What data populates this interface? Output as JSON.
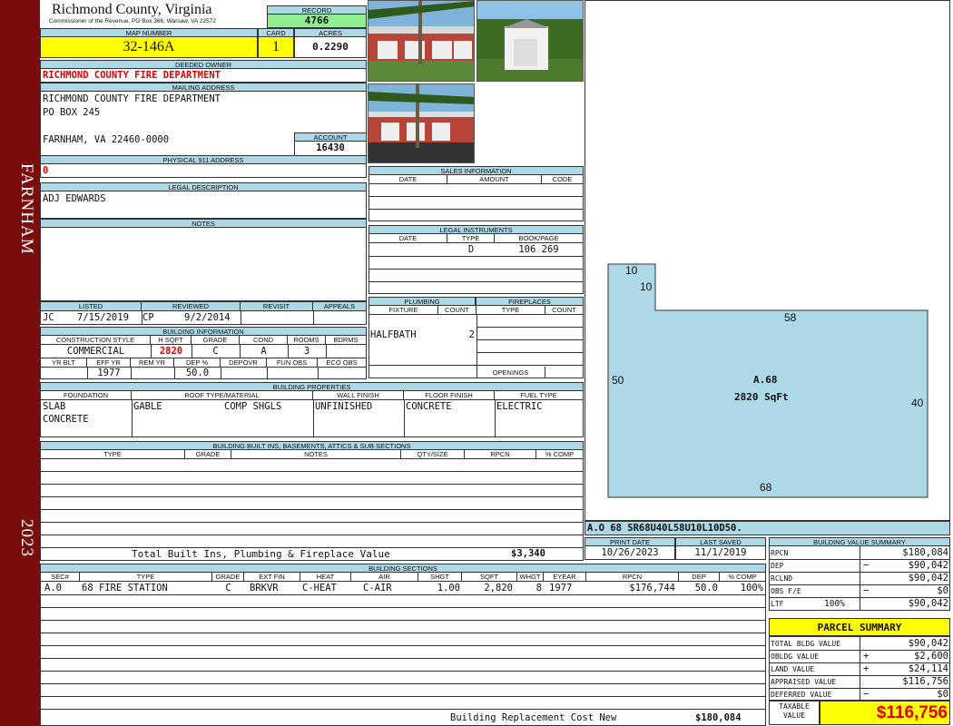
{
  "sidebar": {
    "town": "FARNHAM",
    "year": "2023"
  },
  "header": {
    "county": "Richmond County, Virginia",
    "address": "Commissioner of the Revenue, PO Box 366, Warsaw, VA 22572",
    "record_label": "RECORD",
    "record": "4766",
    "map_number_label": "MAP NUMBER",
    "map_number": "32-146A",
    "card_label": "CARD",
    "card": "1",
    "acres_label": "ACRES",
    "acres": "0.2290"
  },
  "owner": {
    "label": "DEEDED OWNER",
    "name": "RICHMOND COUNTY FIRE DEPARTMENT"
  },
  "mailing": {
    "label": "MAILING ADDRESS",
    "line1": "RICHMOND COUNTY FIRE DEPARTMENT",
    "line2": "PO BOX 245",
    "line3": "FARNHAM, VA 22460-0000"
  },
  "account": {
    "label": "ACCOUNT",
    "value": "16430"
  },
  "physical": {
    "label": "PHYSICAL 911 ADDRESS",
    "value": "0"
  },
  "legal": {
    "label": "LEGAL DESCRIPTION",
    "value": "ADJ EDWARDS"
  },
  "notes": {
    "label": "NOTES"
  },
  "review": {
    "listed_label": "LISTED",
    "reviewed_label": "REVIEWED",
    "revisit_label": "REVISIT",
    "appeals_label": "APPEALS",
    "listed_by": "JC",
    "listed_date": "7/15/2019",
    "reviewed_by": "CP",
    "reviewed_date": "9/2/2014"
  },
  "building_info": {
    "label": "BUILDING INFORMATION",
    "headers": [
      "CONSTRUCTION STYLE",
      "H SQFT",
      "GRADE",
      "COND",
      "ROOMS",
      "BDRMS"
    ],
    "style": "COMMERCIAL",
    "hsqft": "2820",
    "grade": "C",
    "cond": "A",
    "rooms": "3",
    "bdrms": "",
    "headers2": [
      "YR BLT",
      "EFF YR",
      "REM YR",
      "DEP %",
      "DEPOVR",
      "FUN OBS",
      "ECO OBS"
    ],
    "eff_yr": "1977",
    "dep": "50.0"
  },
  "sales": {
    "label": "SALES INFORMATION",
    "headers": [
      "DATE",
      "AMOUNT",
      "CODE"
    ]
  },
  "legal_instruments": {
    "label": "LEGAL INSTRUMENTS",
    "headers": [
      "DATE",
      "TYPE",
      "BOOK/PAGE"
    ],
    "type": "D",
    "bookpage": "106 269"
  },
  "plumbing": {
    "label": "PLUMBING",
    "headers": [
      "FIXTURE",
      "COUNT"
    ],
    "fixture": "HALFBATH",
    "count": "2"
  },
  "fireplaces": {
    "label": "FIREPLACES",
    "headers": [
      "TYPE",
      "COUNT"
    ],
    "openings": "OPENINGS"
  },
  "properties": {
    "label": "BUILDING PROPERTIES",
    "headers": [
      "FOUNDATION",
      "ROOF TYPE/MATERIAL",
      "WALL FINISH",
      "FLOOR FINISH",
      "FUEL TYPE"
    ],
    "foundation1": "SLAB",
    "foundation2": "CONCRETE",
    "roof_type": "GABLE",
    "roof_material": "COMP SHGLS",
    "wall": "UNFINISHED",
    "floor": "CONCRETE",
    "fuel": "ELECTRIC"
  },
  "builtins": {
    "label": "BUILDING BUILT INS, BASEMENTS, ATTICS & SUB SECTIONS",
    "headers": [
      "TYPE",
      "GRADE",
      "NOTES",
      "QTY/SIZE",
      "RPCN",
      "% COMP"
    ],
    "total_label": "Total Built Ins, Plumbing & Fireplace Value",
    "total": "$3,340"
  },
  "sketch": {
    "label_area": "A.68",
    "label_sqft": "2820 SqFt",
    "dims": {
      "top_small": "10",
      "inner": "10",
      "top": "58",
      "left": "50",
      "right": "40",
      "bottom": "68"
    },
    "caption": "A.O  68  SR68U40L58U10L10D50."
  },
  "print": {
    "print_label": "PRINT DATE",
    "saved_label": "LAST SAVED",
    "print_date": "10/26/2023",
    "last_saved": "11/1/2019"
  },
  "sections": {
    "label": "BUILDING SECTIONS",
    "headers": [
      "SEC#",
      "TYPE",
      "GRADE",
      "EXT FIN",
      "HEAT",
      "AIR",
      "SHGT",
      "SQFT",
      "WHGT",
      "EYEAR",
      "RPCN",
      "DEP",
      "% COMP"
    ],
    "row": {
      "sec": "A.0",
      "type": "68 FIRE STATION",
      "grade": "C",
      "extfin": "BRKVR",
      "heat": "C-HEAT",
      "air": "C-AIR",
      "shgt": "1.00",
      "sqft": "2,820",
      "whgt": "8",
      "eyear": "1977",
      "rpcn": "$176,744",
      "dep": "50.0",
      "comp": "100%"
    },
    "rcn_label": "Building Replacement Cost New",
    "rcn": "$180,084"
  },
  "value_summary": {
    "label": "BUILDING VALUE SUMMARY",
    "rpcn_label": "RPCN",
    "rpcn": "$180,084",
    "dep_label": "DEP",
    "dep_sign": "−",
    "dep": "$90,042",
    "rclnd_label": "RCLND",
    "rclnd": "$90,042",
    "obs_label": "OBS F/E",
    "obs_sign": "−",
    "obs": "$0",
    "ltf_label": "LTF",
    "ltf_pct": "100%",
    "ltf": "$90,042"
  },
  "parcel": {
    "label": "PARCEL SUMMARY",
    "total_bldg_label": "TOTAL BLDG VALUE",
    "total_bldg": "$90,042",
    "obldg_label": "OBLDG VALUE",
    "obldg_sign": "+",
    "obldg": "$2,600",
    "land_label": "LAND VALUE",
    "land_sign": "+",
    "land": "$24,114",
    "appraised_label": "APPRAISED VALUE",
    "appraised": "$116,756",
    "deferred_label": "DEFERRED VALUE",
    "deferred_sign": "−",
    "deferred": "$0",
    "taxable_label1": "TAXABLE",
    "taxable_label2": "VALUE",
    "taxable": "$116,756"
  },
  "colors": {
    "sidebar": "#7b0c0c",
    "header_blue": "#add8e6",
    "yellow": "#ffff00",
    "green": "#90ee90",
    "sketch_fill": "#add8e6",
    "red_text": "#e00000"
  }
}
